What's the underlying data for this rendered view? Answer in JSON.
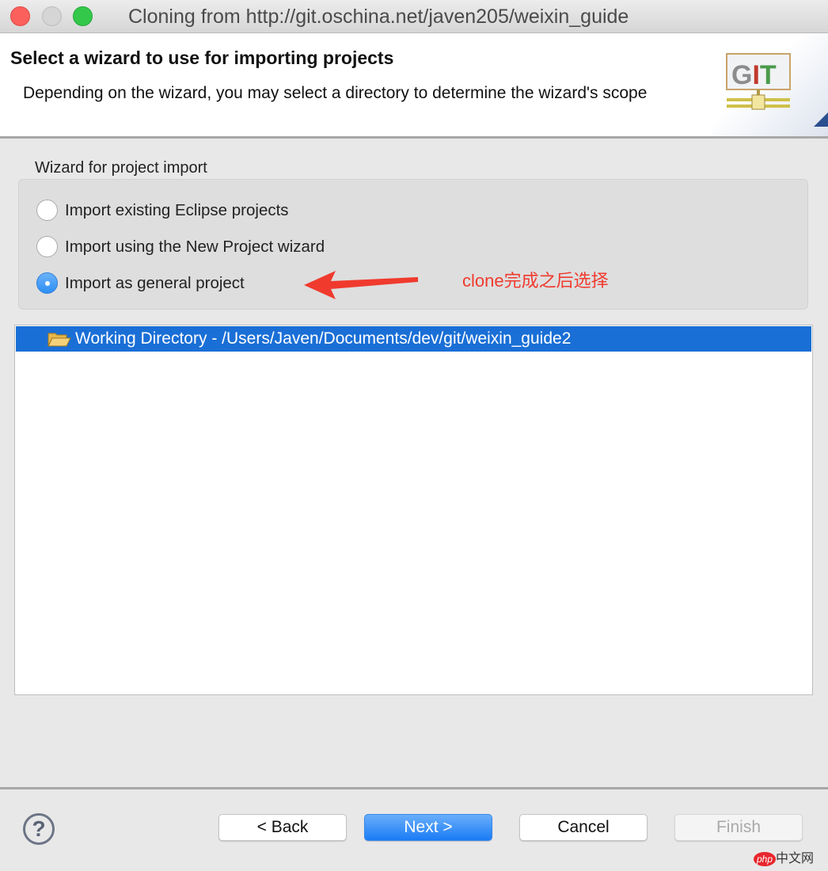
{
  "window": {
    "title": "Cloning from http://git.oschina.net/javen205/weixin_guide"
  },
  "header": {
    "title": "Select a wizard to use for importing projects",
    "description": "Depending on the wizard, you may select a directory to determine the wizard's scope",
    "logo_text": "GIT"
  },
  "wizard_group": {
    "label": "Wizard for project import",
    "options": [
      {
        "label": "Import existing Eclipse projects",
        "selected": false
      },
      {
        "label": "Import using the New Project wizard",
        "selected": false
      },
      {
        "label": "Import as general project",
        "selected": true
      }
    ]
  },
  "annotation": {
    "text": "clone完成之后选择",
    "color": "#f03a2e"
  },
  "tree": {
    "items": [
      {
        "label": "Working Directory - /Users/Javen/Documents/dev/git/weixin_guide2",
        "icon": "folder-open-icon",
        "selected": true
      }
    ]
  },
  "buttons": {
    "back": "< Back",
    "next": "Next >",
    "cancel": "Cancel",
    "finish": "Finish",
    "help": "?"
  },
  "watermark": {
    "text": "php中文网"
  }
}
